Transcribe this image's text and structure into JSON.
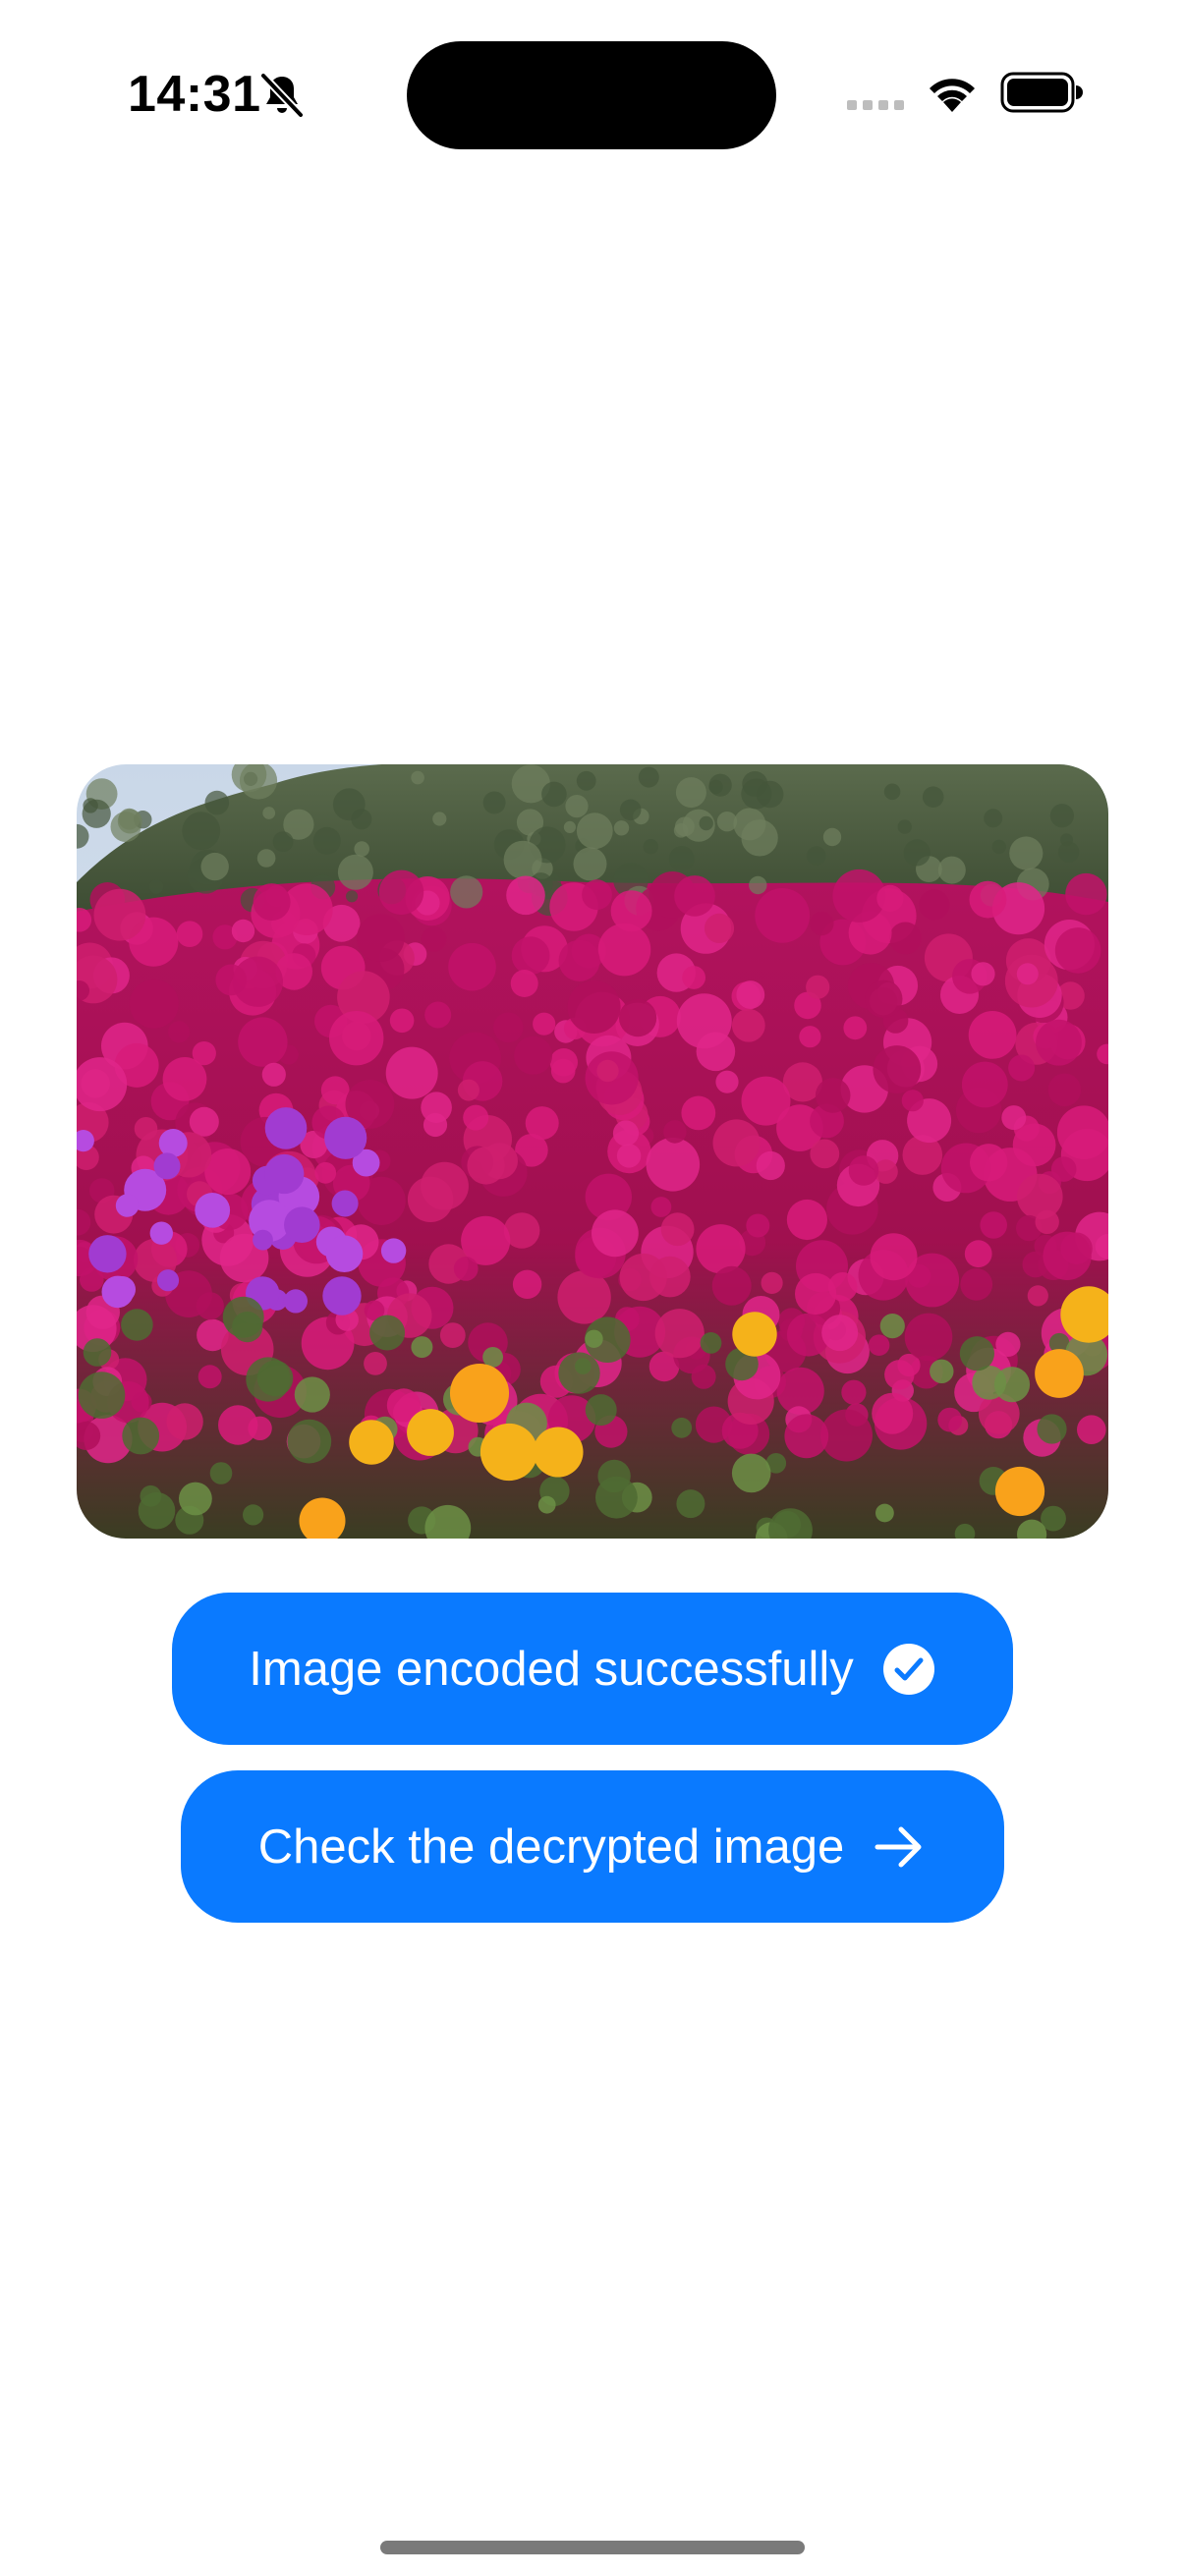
{
  "status_bar": {
    "time": "14:31",
    "icons": [
      "bell-off-icon",
      "signal-dots-icon",
      "wifi-icon",
      "battery-icon"
    ]
  },
  "photo": {
    "subject": "field of magenta, purple and yellow ice plant flowers with a green hedge and sky behind"
  },
  "buttons": {
    "encoded_label": "Image encoded successfully",
    "encoded_icon": "checkmark-circle-icon",
    "decrypt_label": "Check the decrypted image",
    "decrypt_icon": "arrow-right-icon"
  },
  "colors": {
    "accent": "#0a7aff",
    "background": "#ffffff",
    "button_text": "#ffffff"
  }
}
